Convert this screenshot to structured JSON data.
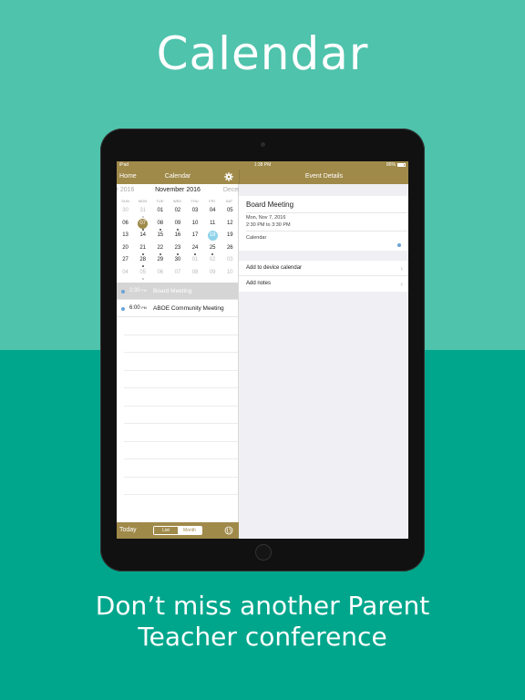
{
  "headline": "Calendar",
  "tagline_line1": "Don’t miss another Parent",
  "tagline_line2": "Teacher conference",
  "device": {
    "status_left": "iPad",
    "status_time": "1:38 PM",
    "status_battery": "86%"
  },
  "left_nav": {
    "back_label": "Home",
    "title": "Calendar",
    "settings_icon": "gear-icon"
  },
  "right_nav": {
    "title": "Event Details"
  },
  "calendar": {
    "prev_month": "e 2016",
    "current_month": "November 2016",
    "next_month": "Decem",
    "weekdays": [
      "SUN",
      "MON",
      "TUE",
      "WED",
      "THU",
      "FRI",
      "SAT"
    ],
    "weeks": [
      [
        "30",
        "31",
        "01",
        "02",
        "03",
        "04",
        "05"
      ],
      [
        "06",
        "07",
        "08",
        "09",
        "10",
        "11",
        "12"
      ],
      [
        "13",
        "14",
        "15",
        "16",
        "17",
        "18",
        "19"
      ],
      [
        "20",
        "21",
        "22",
        "23",
        "24",
        "25",
        "26"
      ],
      [
        "27",
        "28",
        "29",
        "30",
        "01",
        "02",
        "03"
      ],
      [
        "04",
        "05",
        "06",
        "07",
        "08",
        "09",
        "10"
      ]
    ]
  },
  "events": [
    {
      "time": "2:30",
      "ampm": "PM",
      "title": "Board Meeting"
    },
    {
      "time": "6:00",
      "ampm": "PM",
      "title": "ABOE Community Meeting"
    }
  ],
  "toolbar": {
    "today_label": "Today",
    "list_label": "List",
    "month_label": "Month",
    "globe_icon": "globe-icon"
  },
  "event_detail": {
    "title": "Board Meeting",
    "date": "Mon, Nov 7, 2016",
    "time_range": "2:30 PM to 3:30 PM",
    "calendar_name": "Calendar"
  },
  "actions": [
    {
      "label": "Add to device calendar"
    },
    {
      "label": "Add notes"
    }
  ],
  "colors": {
    "top_bg": "#4fc3ac",
    "bottom_bg": "#00a68c",
    "brand_gold": "#a08a4a",
    "today_blue": "#8fd3ea",
    "event_dot": "#6aa3d6"
  }
}
